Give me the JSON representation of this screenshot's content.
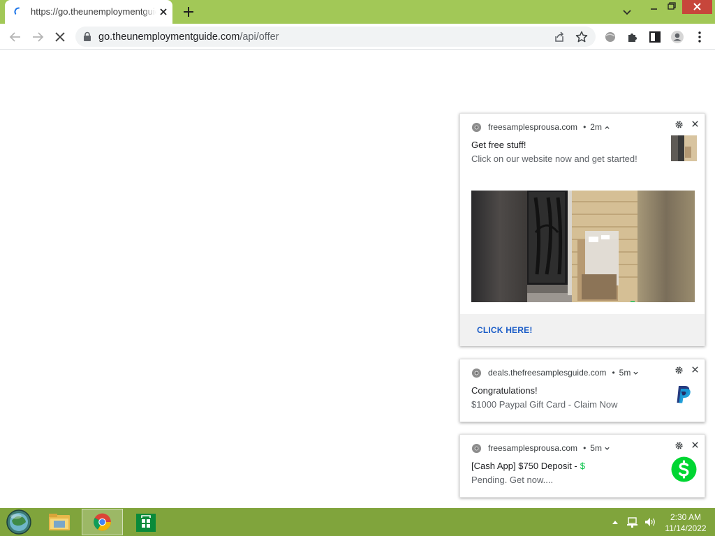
{
  "browser": {
    "tab": {
      "title": "https://go.theunemploymentguide.com/api/offer",
      "state": "loading"
    },
    "omnibox": {
      "domain": "go.theunemploymentguide.com",
      "path": "/api/offer"
    },
    "theme_color": "#a2c857"
  },
  "notifications": [
    {
      "source": "freesamplesprousa.com",
      "time": "2m",
      "expanded": true,
      "title": "Get free stuff!",
      "body": "Click on our website now and get started!",
      "icon": "package-thumbnail-icon",
      "image": "porch-package-photo",
      "action": "CLICK HERE!"
    },
    {
      "source": "deals.thefreesamplesguide.com",
      "time": "5m",
      "expanded": false,
      "title": "Congratulations!",
      "body": "$1000 Paypal Gift Card - Claim Now",
      "icon": "paypal-icon"
    },
    {
      "source": "freesamplesprousa.com",
      "time": "5m",
      "expanded": false,
      "title": "[Cash App] $750 Deposit -",
      "title_symbol": "$",
      "body": "Pending. Get now....",
      "icon": "cash-app-icon"
    }
  ],
  "taskbar": {
    "apps": [
      "start-orb-icon",
      "file-explorer-icon",
      "chrome-icon",
      "store-icon"
    ],
    "active": "chrome-icon",
    "color": "#80a43c",
    "clock": {
      "time": "2:30 AM",
      "date": "11/14/2022"
    }
  }
}
